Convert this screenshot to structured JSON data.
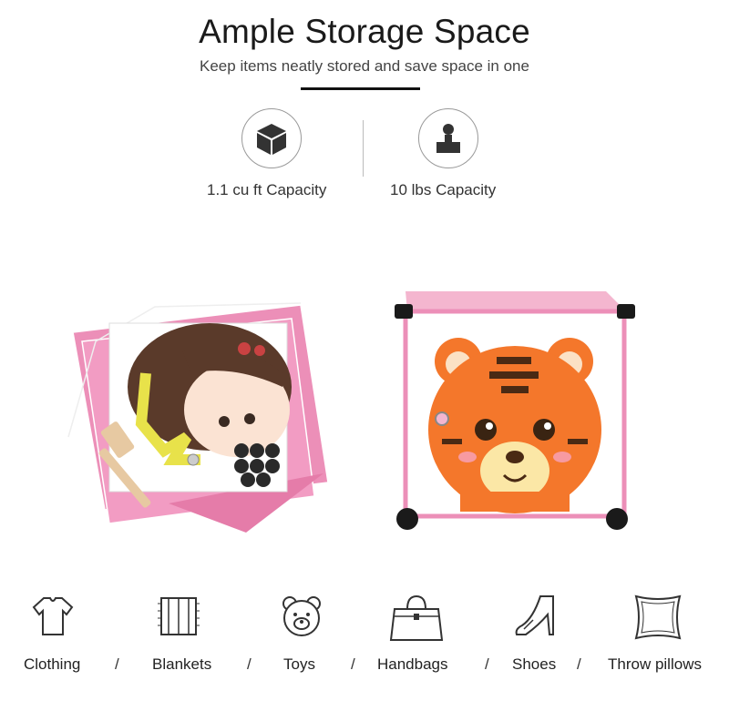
{
  "header": {
    "title": "Ample Storage Space",
    "subtitle": "Keep items neatly stored and save space in one"
  },
  "specs": [
    {
      "label": "1.1 cu ft Capacity",
      "icon": "cube-icon"
    },
    {
      "label": "10 lbs Capacity",
      "icon": "weight-icon"
    }
  ],
  "categories": [
    {
      "label": "Clothing",
      "icon": "tshirt-icon"
    },
    {
      "label": "Blankets",
      "icon": "blanket-icon"
    },
    {
      "label": "Toys",
      "icon": "teddy-bear-icon"
    },
    {
      "label": "Handbags",
      "icon": "handbag-icon"
    },
    {
      "label": "Shoes",
      "icon": "high-heel-icon"
    },
    {
      "label": "Throw pillows",
      "icon": "pillow-icon"
    }
  ],
  "separator": "/",
  "colors": {
    "panel_pink": "#ec8fb8",
    "tiger_orange": "#f4772b",
    "hair_brown": "#5a3a2a"
  }
}
